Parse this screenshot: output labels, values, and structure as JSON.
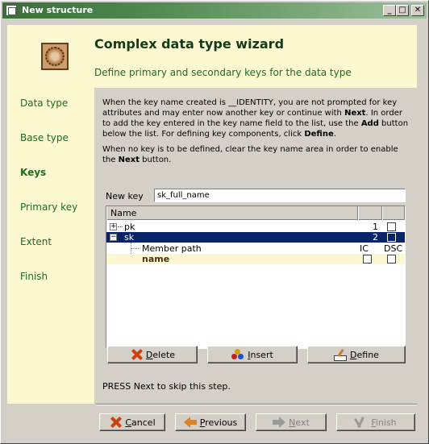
{
  "window": {
    "title": "New structure",
    "minimize_glyph": "_",
    "maximize_glyph": "□",
    "close_glyph": "✕"
  },
  "sidebar": {
    "logo_icon": "data-structure-logo-icon",
    "steps": [
      {
        "label": "Data type",
        "active": false
      },
      {
        "label": "Base type",
        "active": false
      },
      {
        "label": "Keys",
        "active": true
      },
      {
        "label": "Primary key",
        "active": false
      },
      {
        "label": "Extent",
        "active": false
      },
      {
        "label": "Finish",
        "active": false
      }
    ]
  },
  "header": {
    "title": "Complex data type wizard",
    "subtitle": "Define primary and secondary keys for the data type"
  },
  "description": {
    "p1_pre": "When the key name created is __IDENTITY, you are not prompted for key attributes and may enter now another key or continue with ",
    "p1_next": "Next",
    "p1_mid": ". In order to add the key entered in the key name field to the list, use the ",
    "p1_add": "Add",
    "p1_mid2": " button below the list. For defining key components, click ",
    "p1_define": "Define",
    "p1_end": ".",
    "p2_pre": "When no key is to be defined, clear the key name area in order to enable the ",
    "p2_next": "Next",
    "p2_end": " button."
  },
  "new_key": {
    "label": "New key",
    "value": "sk_full_name"
  },
  "tree": {
    "column_name": "Name",
    "rows": {
      "pk": {
        "expander": "+",
        "name": "pk",
        "number": "1"
      },
      "sk": {
        "expander": "−",
        "name": "sk",
        "number": "2"
      },
      "member_path": {
        "label": "Member path",
        "ic": "IC",
        "dsc": "DSC"
      },
      "member": {
        "name": "name"
      }
    }
  },
  "buttons": {
    "delete": {
      "mnemonic": "D",
      "rest": "elete",
      "icon": "delete-icon"
    },
    "insert": {
      "mnemonic": "I",
      "rest": "nsert",
      "icon": "insert-icon"
    },
    "define": {
      "mnemonic": "D",
      "rest": "efine",
      "icon": "define-icon"
    },
    "cancel": {
      "mnemonic": "C",
      "rest": "ancel",
      "icon": "cancel-icon"
    },
    "previous": {
      "mnemonic": "P",
      "rest": "revious",
      "icon": "arrow-left-icon"
    },
    "next": {
      "mnemonic": "N",
      "rest": "ext",
      "icon": "arrow-right-icon",
      "enabled": false
    },
    "finish": {
      "mnemonic": "F",
      "rest": "inish",
      "icon": "finish-icon",
      "enabled": false
    }
  },
  "footer_note": "PRESS Next to skip this step."
}
